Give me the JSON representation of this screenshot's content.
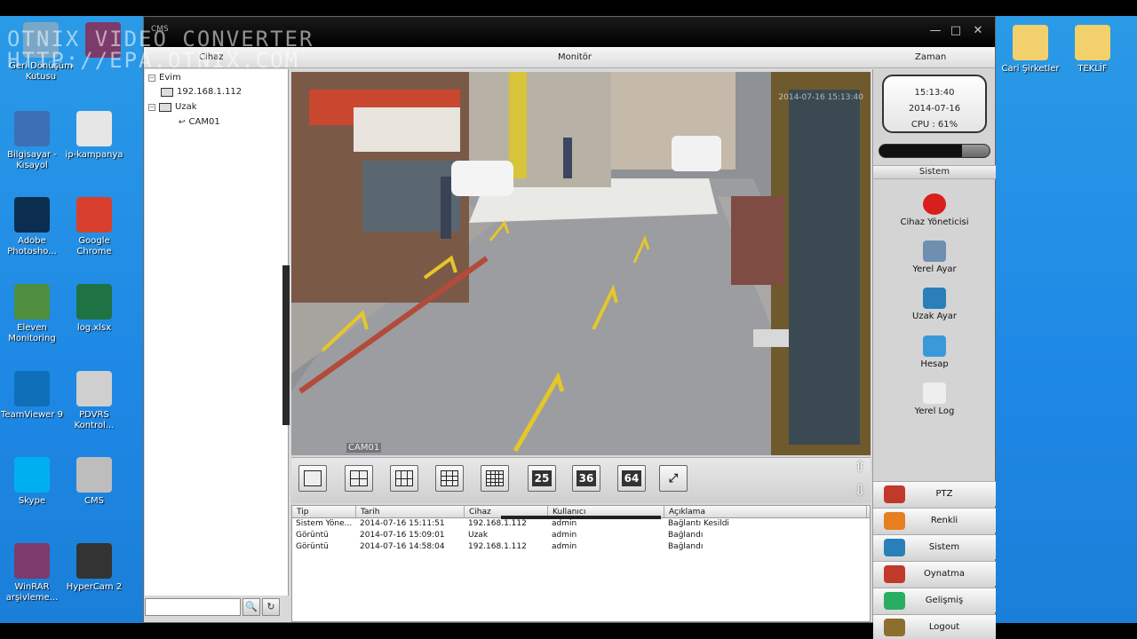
{
  "watermark": {
    "line1": "OTNIX VIDEO CONVERTER",
    "line2": "HTTP://EPA.OTNIX.COM"
  },
  "desktop_left_icons": [
    {
      "label": "Geri Dönüşüm Kutusu",
      "icon": "recycle-bin-icon",
      "color": "#7aa7c7"
    },
    {
      "label": "",
      "icon": "winrar-icon",
      "color": "#7c3b6a"
    },
    {
      "label": "Bilgisayar - Kısayol",
      "icon": "computer-icon",
      "color": "#3d6fb5"
    },
    {
      "label": "ip-kampanya",
      "icon": "document-icon",
      "color": "#e6e6e6"
    },
    {
      "label": "Adobe Photosho...",
      "icon": "photoshop-icon",
      "color": "#0b2d4f"
    },
    {
      "label": "Google Chrome",
      "icon": "chrome-icon",
      "color": "#d8402d"
    },
    {
      "label": "Eleven Monitoring",
      "icon": "excel-monitor-icon",
      "color": "#4f8e3f"
    },
    {
      "label": "log.xlsx",
      "icon": "excel-icon",
      "color": "#1f7244"
    },
    {
      "label": "TeamViewer 9",
      "icon": "teamviewer-icon",
      "color": "#0e6fb8"
    },
    {
      "label": "PDVRS Kontrol...",
      "icon": "control-icon",
      "color": "#cfcfcf"
    },
    {
      "label": "Skype",
      "icon": "skype-icon",
      "color": "#00aff0"
    },
    {
      "label": "CMS",
      "icon": "webcam-icon",
      "color": "#bdbdbd"
    },
    {
      "label": "WinRAR arşivleme...",
      "icon": "winrar-archive-icon",
      "color": "#7c3b6a"
    },
    {
      "label": "HyperCam 2",
      "icon": "hypercam-icon",
      "color": "#333333"
    }
  ],
  "desktop_right_icons": [
    {
      "label": "Cari Şirketler",
      "icon": "folder-icon",
      "color": "#f2d06b"
    },
    {
      "label": "TEKLİF",
      "icon": "folder-icon",
      "color": "#f2d06b"
    }
  ],
  "window": {
    "title": "CMS",
    "minimize": "—",
    "maximize": "□",
    "close": "✕"
  },
  "menu": {
    "left": "Cihaz",
    "center": "Monitör",
    "right": "Zaman"
  },
  "tree": {
    "root_local": "Evim",
    "local_device": "192.168.1.112",
    "root_remote": "Uzak",
    "remote_cam": "CAM01"
  },
  "tree_search_placeholder": "",
  "tree_buttons": {
    "search": "🔍",
    "refresh": "↻"
  },
  "video": {
    "cam_label": "CAM01",
    "osd_time": "2014-07-16 15:13:40"
  },
  "layout_buttons": [
    {
      "name": "layout-1-button",
      "type": "grid",
      "cols": 1
    },
    {
      "name": "layout-4-button",
      "type": "grid",
      "cols": 2
    },
    {
      "name": "layout-6-button",
      "type": "grid",
      "cols": 3,
      "six": true
    },
    {
      "name": "layout-9-button",
      "type": "grid",
      "cols": 3
    },
    {
      "name": "layout-16-button",
      "type": "grid",
      "cols": 4
    },
    {
      "name": "layout-25-button",
      "type": "num",
      "label": "25"
    },
    {
      "name": "layout-36-button",
      "type": "num",
      "label": "36"
    },
    {
      "name": "layout-64-button",
      "type": "num",
      "label": "64"
    },
    {
      "name": "fullscreen-button",
      "type": "full",
      "label": "⤢"
    }
  ],
  "scroll_arrows": {
    "up": "⇧",
    "down": "⇩"
  },
  "log": {
    "headers": [
      "Tip",
      "Tarih",
      "Cihaz",
      "Kullanıcı",
      "Açıklama"
    ],
    "rows": [
      [
        "Sistem Yöne...",
        "2014-07-16 15:11:51",
        "192.168.1.112",
        "admin",
        "Bağlantı Kesildi"
      ],
      [
        "Görüntü",
        "2014-07-16 15:09:01",
        "Uzak",
        "admin",
        "Bağlandı"
      ],
      [
        "Görüntü",
        "2014-07-16 14:58:04",
        "192.168.1.112",
        "admin",
        "Bağlandı"
      ]
    ]
  },
  "clock": {
    "time": "15:13:40",
    "date": "2014-07-16",
    "cpu": "CPU : 61%"
  },
  "cpu_fraction": 0.25,
  "system_header": "Sistem",
  "tools": [
    {
      "label": "Cihaz Yöneticisi",
      "icon": "record-icon",
      "color": "#d91e1e"
    },
    {
      "label": "Yerel Ayar",
      "icon": "local-settings-icon",
      "color": "#6e8fb0"
    },
    {
      "label": "Uzak Ayar",
      "icon": "remote-settings-icon",
      "color": "#2a7fb8"
    },
    {
      "label": "Hesap",
      "icon": "account-icon",
      "color": "#3a9ad9"
    },
    {
      "label": "Yerel Log",
      "icon": "log-file-icon",
      "color": "#eeeeee"
    }
  ],
  "nav": [
    {
      "label": "PTZ",
      "icon": "ptz-icon",
      "color": "#c0392b"
    },
    {
      "label": "Renkli",
      "icon": "color-icon",
      "color": "#e67e22"
    },
    {
      "label": "Sistem",
      "icon": "system-icon",
      "color": "#2980b9"
    },
    {
      "label": "Oynatma",
      "icon": "playback-icon",
      "color": "#c0392b"
    },
    {
      "label": "Gelişmiş",
      "icon": "advanced-icon",
      "color": "#27ae60"
    },
    {
      "label": "Logout",
      "icon": "logout-icon",
      "color": "#8e6e2e"
    }
  ]
}
